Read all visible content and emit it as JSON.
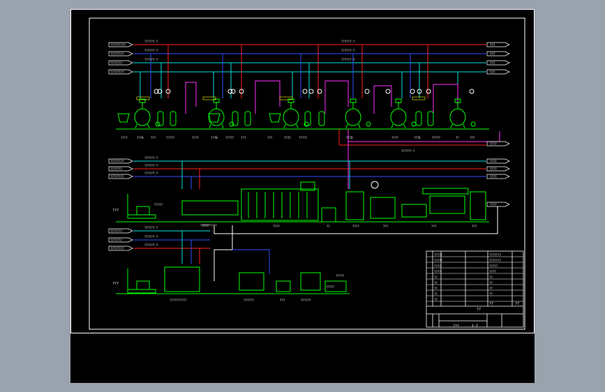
{
  "colors": {
    "background": "#000000",
    "page": "#9aa3ad",
    "frame": "#ffffff",
    "equipment": "#00ff00",
    "line_red": "#ff2020",
    "line_blue": "#3050ff",
    "line_cyan": "#00e0e0",
    "line_magenta": "#ff30ff",
    "line_white": "#ffffff",
    "text_white": "#ffffff",
    "text_yellow": "#ffff00",
    "label_green": "#00ff00"
  },
  "inlets": {
    "top": [
      "?????????",
      "????????",
      "???????",
      "????????"
    ],
    "mid": [
      "????????",
      "???????",
      "????????"
    ],
    "bottom": [
      "???????",
      "???????",
      "????????"
    ]
  },
  "outlets": {
    "top": [
      "???",
      "???",
      "???",
      "???"
    ],
    "mid": [
      "????",
      "????",
      "????",
      "????"
    ],
    "side": "????"
  },
  "pipe_labels": {
    "top_left": [
      "??????-?",
      "??????-?",
      "??????-?"
    ],
    "top_right": [
      "??????-?",
      "??????-?",
      "??????-?"
    ],
    "mid_left": [
      "??????-?",
      "??????-?",
      "??????-?"
    ],
    "bottom_left": [
      "??????-?",
      "??????-?",
      "??????-?"
    ],
    "center": "??????-?"
  },
  "process_labels": {
    "row1": [
      "????",
      "???A",
      "???",
      "?????",
      "????",
      "???B",
      "?????",
      "???",
      "???",
      "???C",
      "?????",
      "???D",
      "????",
      "???E",
      "?????",
      "??",
      "???"
    ],
    "row2": [
      "?????",
      "?????",
      "?????????",
      "????",
      "??",
      "????",
      "???",
      "???",
      "???"
    ],
    "row3": [
      "?????",
      "??????????",
      "??????",
      "???",
      "??????",
      "?????"
    ]
  },
  "side_tags": {
    "row2": "???",
    "row3": "???"
  },
  "title_block": {
    "rows": [
      "?????",
      "?????",
      "????",
      "????",
      "??",
      "??",
      "??",
      "??",
      "??"
    ],
    "values": [
      "???????",
      "???????",
      "?????",
      "????",
      "??",
      "??",
      "??",
      "??"
    ],
    "project": "???",
    "scale": "1:1",
    "sheet": "??",
    "drawing_no": "??",
    "approval": "??"
  }
}
